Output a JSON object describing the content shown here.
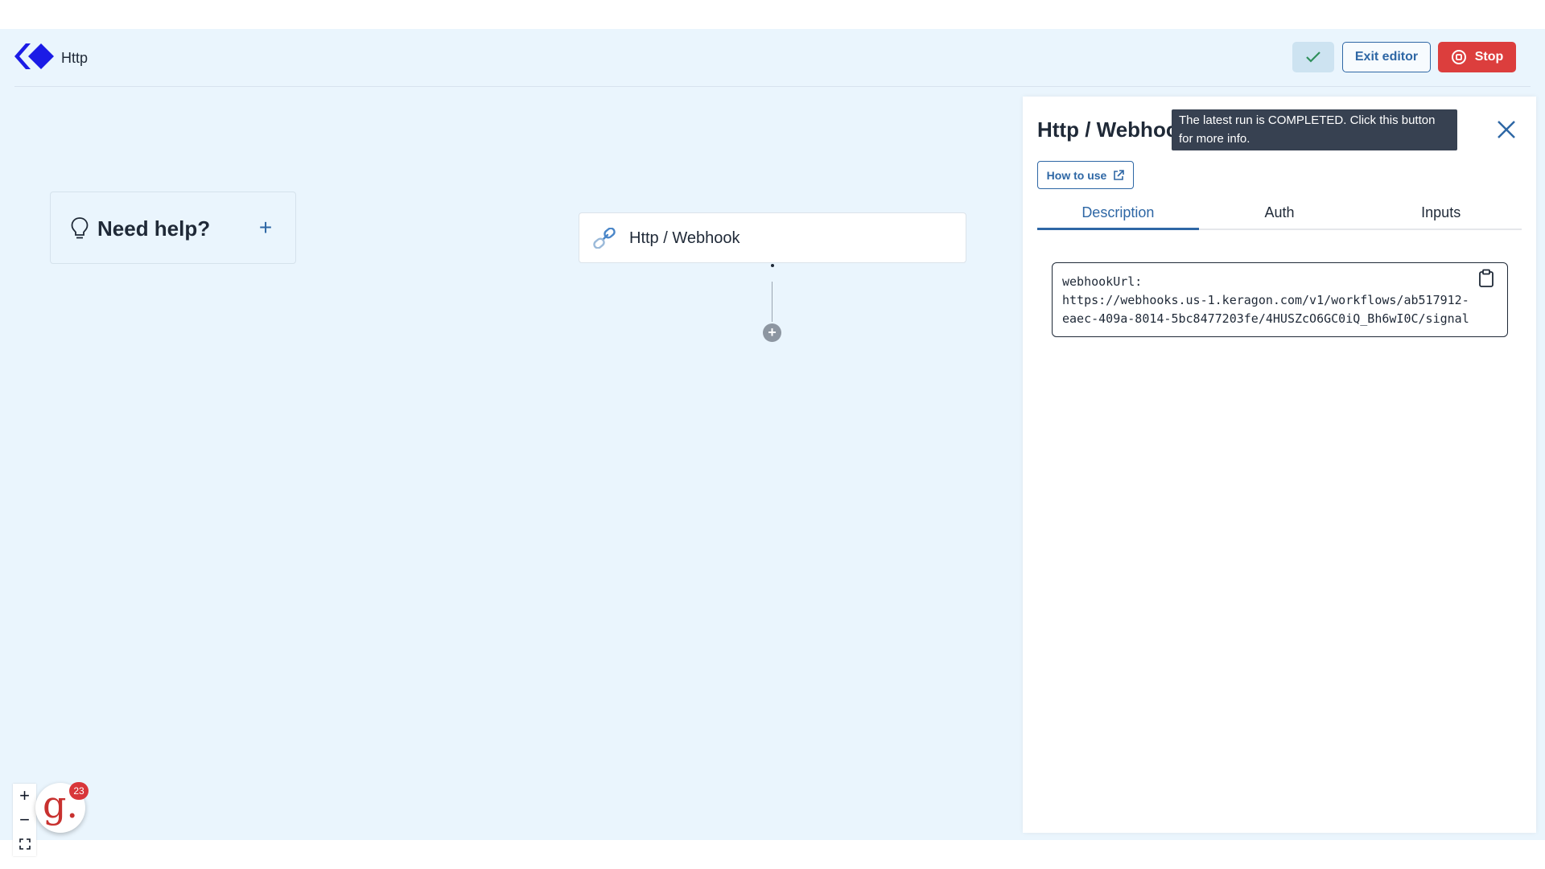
{
  "header": {
    "app_title": "Http",
    "exit_editor_label": "Exit editor",
    "stop_label": "Stop"
  },
  "tooltip": {
    "text": "The latest run is COMPLETED. Click this button for more info."
  },
  "help_card": {
    "title": "Need help?",
    "expand_symbol": "+"
  },
  "node": {
    "label": "Http / Webhook",
    "add_symbol": "+"
  },
  "panel": {
    "title": "Http / Webhook",
    "how_to_use_label": "How to use",
    "tabs": [
      {
        "label": "Description",
        "active": true
      },
      {
        "label": "Auth",
        "active": false
      },
      {
        "label": "Inputs",
        "active": false
      }
    ],
    "webhook_text": "webhookUrl:\nhttps://webhooks.us-1.keragon.com/v1/workflows/ab517912-\neaec-409a-8014-5bc8477203fe/4HUSZcO6GC0iQ_Bh6wI0C/signal"
  },
  "zoom": {
    "in_symbol": "+",
    "out_symbol": "−"
  },
  "badge": {
    "letter": "g.",
    "count": "23"
  },
  "colors": {
    "canvas_bg": "#eaf5fd",
    "accent": "#2e67a5",
    "stop_red": "#dc3e3d",
    "logo_blue": "#1b1be6",
    "check_green": "#2f8f5b"
  },
  "icons": {
    "logo": "keragon-logo-icon",
    "run_status": "check-icon",
    "stop": "stop-circle-icon",
    "help": "lightbulb-icon",
    "node": "link-icon",
    "close": "close-icon",
    "external": "external-link-icon",
    "copy": "clipboard-icon",
    "fit": "fit-view-icon"
  }
}
